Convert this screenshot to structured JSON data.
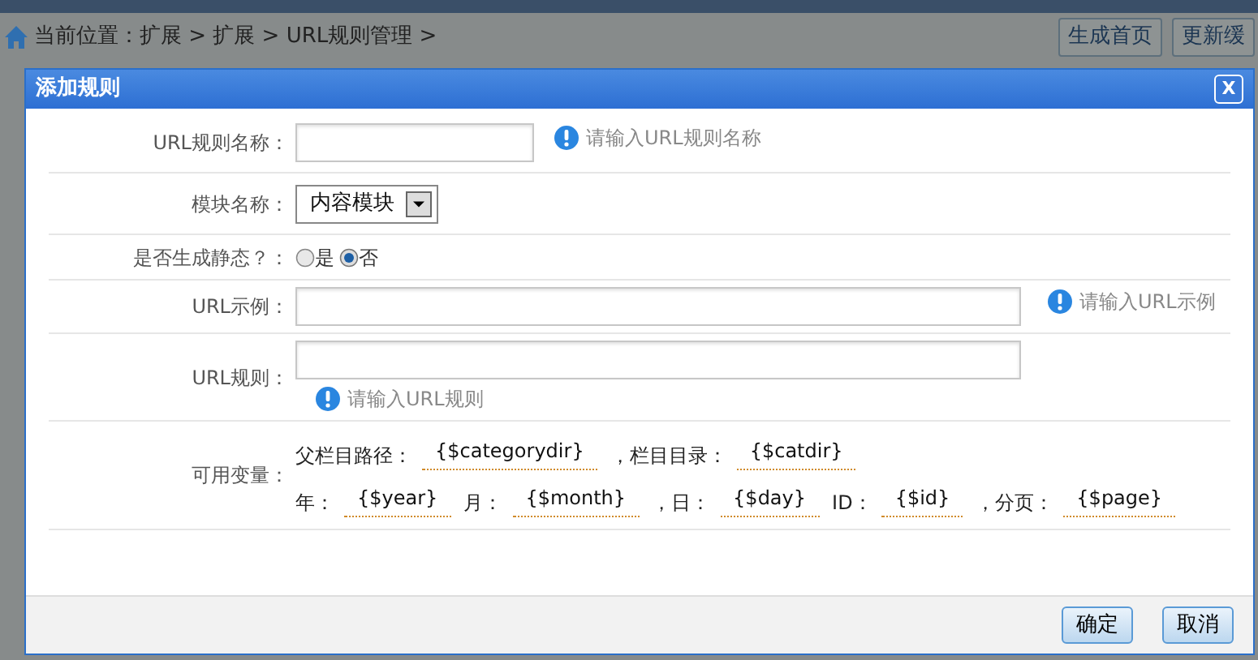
{
  "breadcrumb": "当前位置：扩展 > 扩展 > URL规则管理 >",
  "top_buttons": [
    "生成首页",
    "更新缓"
  ],
  "dialog": {
    "title": "添加规则",
    "close": "X",
    "rows": [
      {
        "kind": "text",
        "label": "URL规则名称：",
        "wide": false,
        "hint": "请输入URL规则名称"
      },
      {
        "kind": "select",
        "label": "模块名称：",
        "value": "内容模块"
      },
      {
        "kind": "radio",
        "label": "是否生成静态？：",
        "options": [
          {
            "label": "是",
            "selected": false
          },
          {
            "label": "否",
            "selected": true
          }
        ]
      },
      {
        "kind": "text",
        "label": "URL示例：",
        "wide": true,
        "hint": "请输入URL示例"
      },
      {
        "kind": "text_hint_below",
        "label": "URL规则：",
        "wide": true,
        "hint": "请输入URL规则"
      },
      {
        "kind": "vars",
        "label": "可用变量：",
        "lines": [
          [
            {
              "label": "父栏目路径：",
              "value": "{$categorydir}"
            },
            {
              "label": "，栏目目录：",
              "value": "{$catdir}"
            }
          ],
          [
            {
              "label": "年：",
              "value": "{$year}"
            },
            {
              "label": "月：",
              "value": "{$month}"
            },
            {
              "label": "，日：",
              "value": "{$day}"
            },
            {
              "label": "ID：",
              "value": "{$id}"
            },
            {
              "label": "，分页：",
              "value": "{$page}"
            }
          ]
        ]
      }
    ],
    "buttons": [
      "确定",
      "取消"
    ]
  }
}
